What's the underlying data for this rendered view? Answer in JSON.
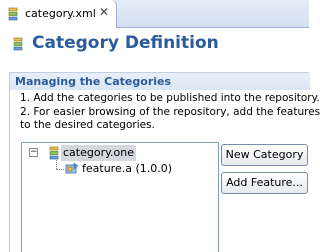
{
  "tab": {
    "label": "category.xml",
    "close_glyph": "✕",
    "icon": "category-file-icon"
  },
  "header": {
    "title": "Category Definition",
    "icon": "category-definition-icon"
  },
  "section": {
    "title": "Managing the Categories",
    "description_lines": [
      "1. Add the categories to be published into the repository.",
      "2. For easier browsing of the repository, add the features",
      "to the desired categories."
    ]
  },
  "tree": {
    "toggle_glyph": "−",
    "root": {
      "label": "category.one",
      "icon": "category-icon",
      "expanded": true,
      "selected": true,
      "children": [
        {
          "label": "feature.a (1.0.0)",
          "icon": "feature-icon"
        }
      ]
    }
  },
  "buttons": {
    "new_category": "New Category",
    "add_feature": "Add Feature..."
  },
  "colors": {
    "title_blue": "#2b5b9b",
    "selection_gray": "#d4d8dd",
    "section_border": "#c1cfe2"
  }
}
